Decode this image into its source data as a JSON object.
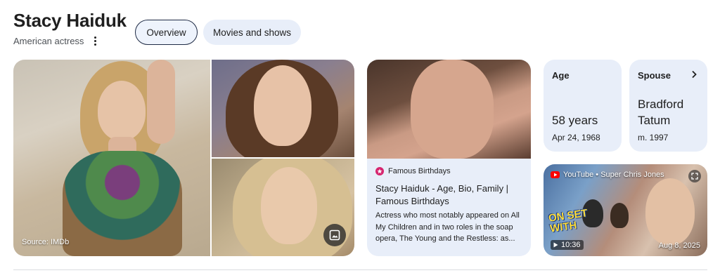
{
  "header": {
    "name": "Stacy Haiduk",
    "description": "American actress",
    "more_icon": "more-vert-icon"
  },
  "tabs": [
    {
      "label": "Overview",
      "selected": true
    },
    {
      "label": "Movies and shows",
      "selected": false
    }
  ],
  "images": {
    "main_source": "Source: IMDb",
    "gallery_icon": "image-icon"
  },
  "article": {
    "source_name": "Famous Birthdays",
    "title": "Stacy Haiduk - Age, Bio, Family | Famous Birthdays",
    "snippet": "Actress who most notably appeared on All My Children and in two roles in the soap opera, The Young and the Restless: as..."
  },
  "facts": {
    "age": {
      "label": "Age",
      "value": "58 years",
      "sub": "Apr 24, 1968"
    },
    "spouse": {
      "label": "Spouse",
      "value_line1": "Bradford",
      "value_line2": "Tatum",
      "sub": "m. 1997"
    }
  },
  "video": {
    "source": "YouTube • Super Chris Jones",
    "caption_line1": "ON SET",
    "caption_line2": "WITH",
    "duration": "10:36",
    "date": "Aug 8, 2025"
  },
  "colors": {
    "card_bg": "#e8eef9",
    "chip_border": "#1f2b45",
    "favicon": "#d6256f",
    "youtube_red": "#ff0000"
  }
}
